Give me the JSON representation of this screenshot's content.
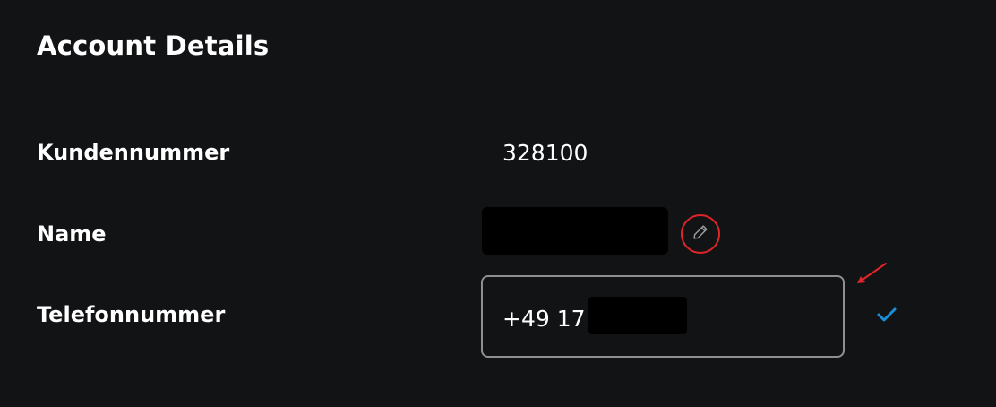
{
  "header": {
    "title": "Account Details"
  },
  "fields": {
    "customer_number": {
      "label": "Kundennummer",
      "value": "328100"
    },
    "name": {
      "label": "Name"
    },
    "phone": {
      "label": "Telefonnummer",
      "value": "+49 171"
    }
  },
  "icons": {
    "edit": "pencil-icon",
    "confirm": "checkmark-icon",
    "annotation": "arrow-icon"
  },
  "colors": {
    "background": "#121315",
    "text": "#ffffff",
    "edit_ring": "#e0252a",
    "field_border": "#8d8f93",
    "confirm": "#1a8fd6",
    "annotation_arrow": "#e0252a"
  }
}
